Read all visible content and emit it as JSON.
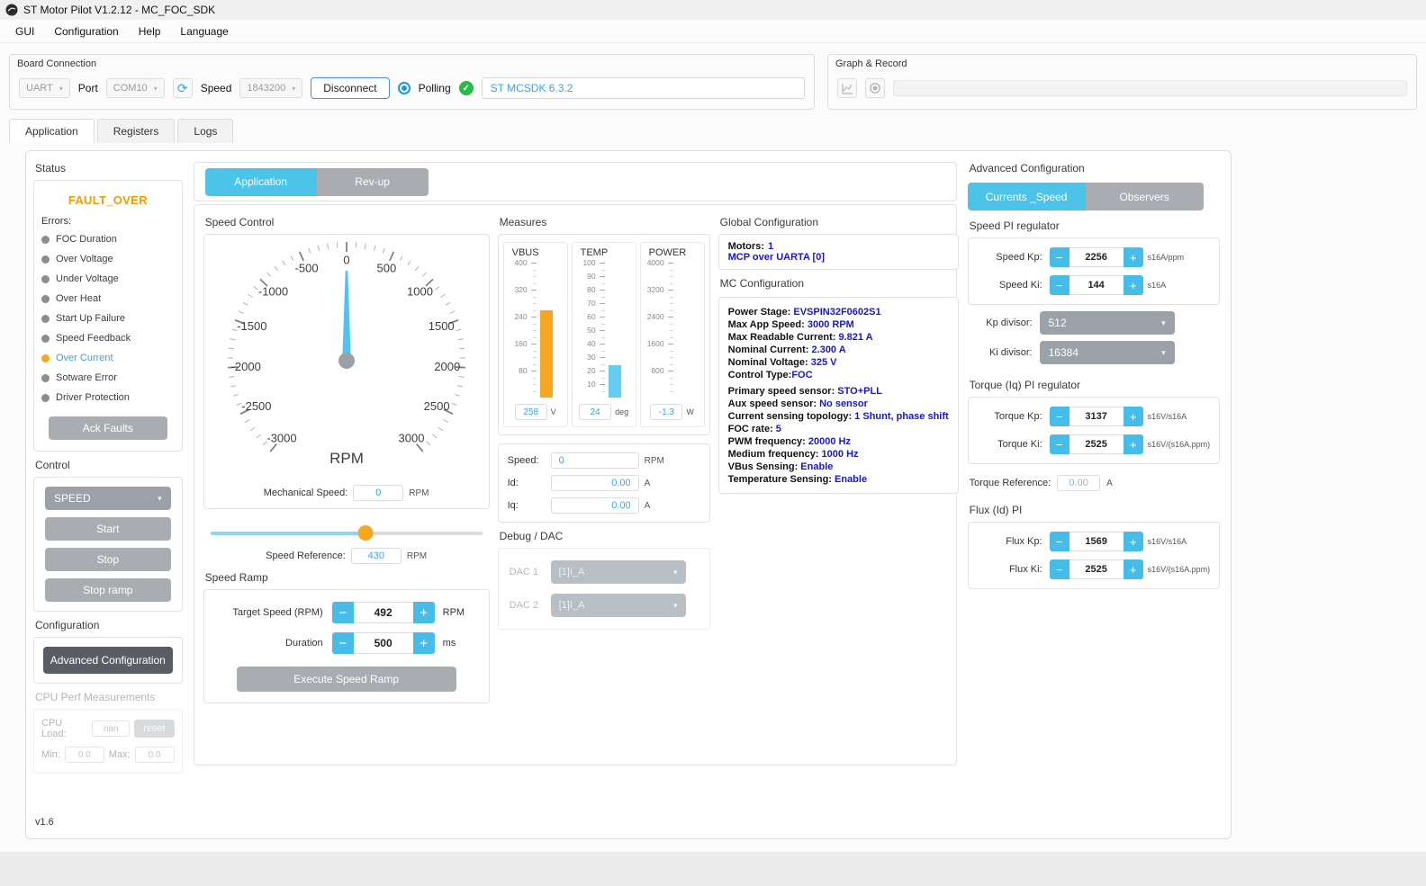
{
  "window": {
    "title": "ST Motor Pilot V1.2.12 - MC_FOC_SDK",
    "menu": [
      "GUI",
      "Configuration",
      "Help",
      "Language"
    ]
  },
  "icons": {
    "minus": "−",
    "plus": "+",
    "chevron_down": "▾",
    "check": "✓",
    "refresh": "⟳"
  },
  "colors": {
    "accent_cyan": "#45bde8",
    "tab_active_cyan": "#4cc3e8",
    "fault_orange": "#f59b00",
    "bar_orange": "#f5a623",
    "bar_blue": "#66cdf2",
    "needle_blue": "#4fc3f7",
    "value_blue": "#36a9e1",
    "config_navy": "#1616d1",
    "active_error_blue": "#3f9fd9",
    "ok_green": "#28b946"
  },
  "board_connection": {
    "title": "Board Connection",
    "bus_value": "UART",
    "port_label": "Port",
    "port_value": "COM10",
    "speed_label": "Speed",
    "speed_value": "1843200",
    "disconnect_label": "Disconnect",
    "polling_label": "Polling",
    "firmware": "ST MCSDK 6.3.2"
  },
  "graph_record": {
    "title": "Graph & Record"
  },
  "main_tabs": {
    "application": "Application",
    "registers": "Registers",
    "logs": "Logs"
  },
  "status_panel": {
    "title": "Status",
    "fault": "FAULT_OVER",
    "errors_label": "Errors:",
    "errors": [
      {
        "label": "FOC Duration",
        "state": "off"
      },
      {
        "label": "Over Voltage",
        "state": "off"
      },
      {
        "label": "Under Voltage",
        "state": "off"
      },
      {
        "label": "Over Heat",
        "state": "off"
      },
      {
        "label": "Start Up Failure",
        "state": "off"
      },
      {
        "label": "Speed Feedback",
        "state": "off"
      },
      {
        "label": "Over Current",
        "state": "on"
      },
      {
        "label": "Sotware Error",
        "state": "off"
      },
      {
        "label": "Driver Protection",
        "state": "off"
      }
    ],
    "ack_faults_label": "Ack Faults"
  },
  "control_panel": {
    "title": "Control",
    "mode_value": "SPEED",
    "start_label": "Start",
    "stop_label": "Stop",
    "stop_ramp_label": "Stop ramp"
  },
  "configuration_panel": {
    "title": "Configuration",
    "advanced_button": "Advanced Configuration"
  },
  "cpu_panel": {
    "title": "CPU Perf Measurements",
    "cpu_load_label": "CPU Load:",
    "cpu_load_value": "nan",
    "reset_label": "reset",
    "min_label": "Min:",
    "min_value": "0.0",
    "max_label": "Max:",
    "max_value": "0.0"
  },
  "version": "v1.6",
  "center": {
    "tabs": {
      "application": "Application",
      "revup": "Rev-up"
    },
    "speed_control": {
      "title": "Speed Control",
      "gauge": {
        "min": -3000,
        "max": 3000,
        "major_step": 500,
        "minor_step": 100,
        "angle_span": 140,
        "value": 0,
        "unit": "RPM"
      },
      "mechanical_speed_label": "Mechanical Speed:",
      "mechanical_speed_value": "0",
      "mechanical_speed_unit": "RPM",
      "speed_reference_label": "Speed Reference:",
      "speed_reference_value": "430",
      "speed_reference_unit": "RPM"
    },
    "speed_ramp": {
      "title": "Speed Ramp",
      "target_label": "Target Speed (RPM)",
      "target_value": "492",
      "target_unit": "RPM",
      "duration_label": "Duration",
      "duration_value": "500",
      "duration_unit": "ms",
      "execute_label": "Execute Speed Ramp"
    },
    "measures": {
      "title": "Measures",
      "gauges": [
        {
          "name": "VBUS",
          "max": 400,
          "ticks": [
            400,
            320,
            240,
            160,
            80
          ],
          "minor_step": 20,
          "value": 258,
          "unit": "V",
          "bar_color": "#f5a623"
        },
        {
          "name": "TEMP",
          "max": 100,
          "ticks": [
            100,
            90,
            80,
            70,
            60,
            50,
            40,
            30,
            20,
            10
          ],
          "minor_step": 5,
          "value": 24,
          "unit": "deg",
          "bar_color": "#66cdf2"
        },
        {
          "name": "POWER",
          "max": 4000,
          "ticks": [
            4000,
            3200,
            2400,
            1600,
            800
          ],
          "minor_step": 200,
          "value": -1.3,
          "unit": "W",
          "bar_color": "#66cdf2"
        }
      ],
      "speed_label": "Speed:",
      "speed_value": "0",
      "speed_unit": "RPM",
      "id_label": "Id:",
      "id_value": "0.00",
      "id_unit": "A",
      "iq_label": "Iq:",
      "iq_value": "0.00",
      "iq_unit": "A"
    },
    "debug_dac": {
      "title": "Debug / DAC",
      "dac1_label": "DAC 1",
      "dac1_value": "[1]I_A",
      "dac2_label": "DAC 2",
      "dac2_value": "[1]I_A"
    },
    "global_config": {
      "title": "Global Configuration",
      "motors_label": "Motors:",
      "motors_value": "1",
      "link": "MCP over UARTA [0]"
    },
    "mc_config": {
      "title": "MC Configuration",
      "lines": [
        {
          "label": "Power Stage:",
          "value": "EVSPIN32F0602S1"
        },
        {
          "label": "Max App Speed:",
          "value": "3000 RPM"
        },
        {
          "label": "Max Readable Current:",
          "value": "9.821 A"
        },
        {
          "label": "Nominal Current:",
          "value": "2.300 A"
        },
        {
          "label": "Nominal Voltage:",
          "value": "325 V"
        },
        {
          "label": "Control Type:",
          "value": "FOC",
          "sep": "",
          "gap_after": true
        },
        {
          "label": "Primary speed sensor:",
          "value": "STO+PLL"
        },
        {
          "label": "Aux speed sensor:",
          "value": "No sensor"
        },
        {
          "label": "Current sensing topology:",
          "value": "1 Shunt, phase shift"
        },
        {
          "label": "FOC rate:",
          "value": "5"
        },
        {
          "label": "PWM frequency:",
          "value": "20000 Hz"
        },
        {
          "label": "Medium frequency:",
          "value": "1000 Hz"
        },
        {
          "label": "VBus Sensing:",
          "value": "Enable"
        },
        {
          "label": "Temperature Sensing:",
          "value": "Enable"
        }
      ]
    }
  },
  "advanced": {
    "title": "Advanced Configuration",
    "tabs": {
      "currents": "Currents _Speed",
      "observers": "Observers"
    },
    "speed_pi": {
      "title": "Speed PI regulator",
      "kp_label": "Speed Kp:",
      "kp_value": "2256",
      "kp_unit": "s16A/ppm",
      "ki_label": "Speed Ki:",
      "ki_value": "144",
      "ki_unit": "s16A",
      "kp_divisor_label": "Kp divisor:",
      "kp_divisor_value": "512",
      "ki_divisor_label": "Ki divisor:",
      "ki_divisor_value": "16384"
    },
    "torque_pi": {
      "title": "Torque (Iq) PI regulator",
      "kp_label": "Torque Kp:",
      "kp_value": "3137",
      "kp_unit": "s16V/s16A",
      "ki_label": "Torque Ki:",
      "ki_value": "2525",
      "ki_unit": "s16V/(s16A.ppm)"
    },
    "torque_reference": {
      "label": "Torque Reference:",
      "value": "0.00",
      "unit": "A"
    },
    "flux_pi": {
      "title": "Flux (Id) PI",
      "kp_label": "Flux Kp:",
      "kp_value": "1569",
      "kp_unit": "s16V/s16A",
      "ki_label": "Flux Ki:",
      "ki_value": "2525",
      "ki_unit": "s16V/(s16A.ppm)"
    }
  }
}
